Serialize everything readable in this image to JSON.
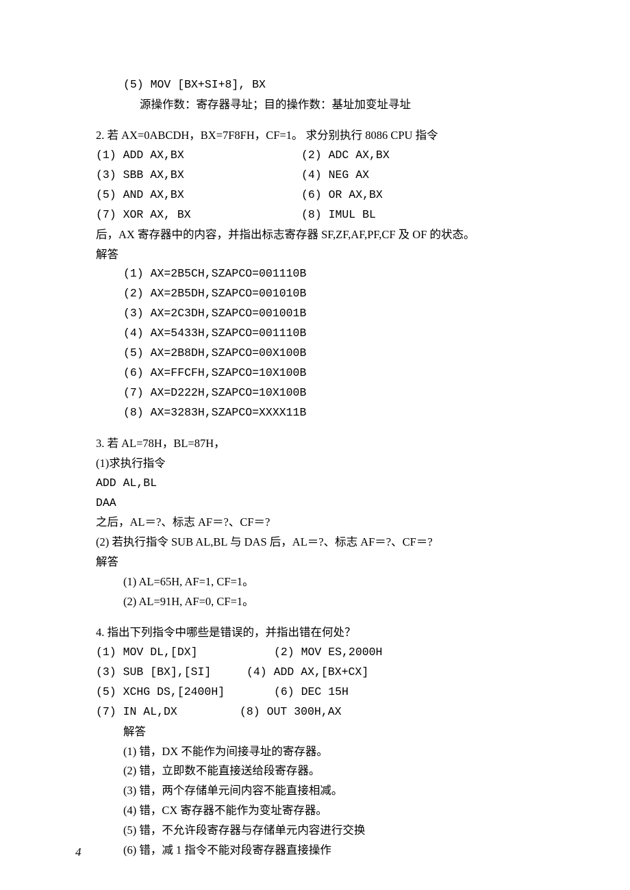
{
  "sec1": {
    "item5_code": "(5) MOV [BX+SI+8], BX",
    "item5_desc": "源操作数：寄存器寻址；目的操作数：基址加变址寻址"
  },
  "sec2": {
    "title": "2. 若 AX=0ABCDH，BX=7F8FH，CF=1。  求分别执行 8086 CPU 指令",
    "items": [
      "(1) ADD   AX,BX",
      "(2) ADC   AX,BX",
      "(3) SBB   AX,BX",
      "(4) NEG   AX",
      "(5) AND AX,BX",
      "(6) OR    AX,BX",
      "(7) XOR   AX, BX",
      "(8) IMUL BL"
    ],
    "after": "后，AX 寄存器中的内容，并指出标志寄存器 SF,ZF,AF,PF,CF 及 OF 的状态。",
    "ans_label": "解答",
    "answers": [
      "(1) AX=2B5CH,SZAPCO=001110B",
      "(2) AX=2B5DH,SZAPCO=001010B",
      "(3) AX=2C3DH,SZAPCO=001001B",
      "(4) AX=5433H,SZAPCO=001110B",
      "(5) AX=2B8DH,SZAPCO=00X100B",
      "(6) AX=FFCFH,SZAPCO=10X100B",
      "(7) AX=D222H,SZAPCO=10X100B",
      "(8) AX=3283H,SZAPCO=XXXX11B"
    ]
  },
  "sec3": {
    "title": "3. 若 AL=78H，BL=87H，",
    "line2": "(1)求执行指令",
    "line3": "ADD AL,BL",
    "line4": "DAA",
    "line5": "之后，AL＝?、标志 AF＝?、CF＝?",
    "line6": "(2) 若执行指令 SUB AL,BL 与 DAS 后，AL＝?、标志 AF＝?、CF＝?",
    "ans_label": "解答",
    "answers": [
      "(1) AL=65H, AF=1, CF=1。",
      "(2) AL=91H, AF=0, CF=1。"
    ]
  },
  "sec4": {
    "title": "4. 指出下列指令中哪些是错误的，并指出错在何处？",
    "items": [
      "(1) MOV DL,[DX]",
      "(2) MOV ES,2000H",
      "(3) SUB [BX],[SI]",
      "(4) ADD AX,[BX+CX]",
      "(5) XCHG DS,[2400H]",
      "(6) DEC 15H",
      "(7) IN AL,DX",
      "(8) OUT 300H,AX"
    ],
    "ans_label": "解答",
    "answers": [
      "(1) 错，DX 不能作为间接寻址的寄存器。",
      "(2) 错，立即数不能直接送给段寄存器。",
      "(3) 错，两个存储单元间内容不能直接相减。",
      "(4) 错，CX 寄存器不能作为变址寄存器。",
      "(5) 错，不允许段寄存器与存储单元内容进行交换",
      "(6) 错，减 1 指令不能对段寄存器直接操作"
    ]
  },
  "page_number": "4"
}
